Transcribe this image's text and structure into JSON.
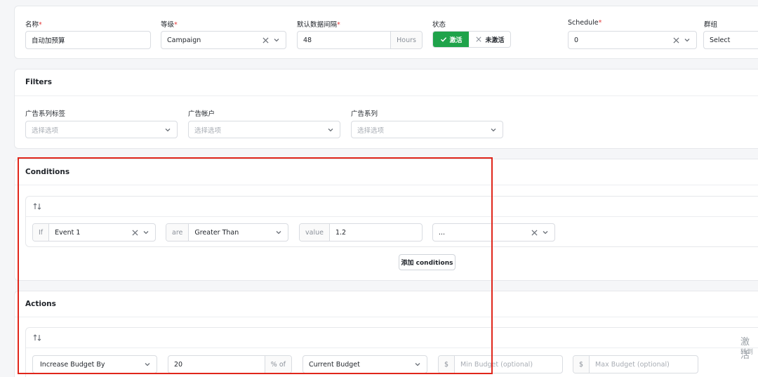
{
  "general": {
    "name_label": "名称",
    "name_value": "自动加预算",
    "level_label": "等级",
    "level_value": "Campaign",
    "interval_label": "默认数据间隔",
    "interval_value": "48",
    "interval_unit": "Hours",
    "status_label": "状态",
    "status_active": "激活",
    "status_inactive": "未激活",
    "schedule_label": "Schedule",
    "schedule_value": "0",
    "group_label": "群组",
    "group_value": "Select",
    "required_mark": "*"
  },
  "filters": {
    "title": "Filters",
    "items": [
      {
        "label": "广告系列标签",
        "placeholder": "选择选项"
      },
      {
        "label": "广告帐户",
        "placeholder": "选择选项"
      },
      {
        "label": "广告系列",
        "placeholder": "选择选项"
      }
    ]
  },
  "conditions": {
    "title": "Conditions",
    "if_label": "If",
    "event_value": "Event 1",
    "are_label": "are",
    "operator_value": "Greater Than",
    "value_label": "value",
    "value_value": "1.2",
    "extra_value": "...",
    "add_button": "添加 conditions"
  },
  "actions": {
    "title": "Actions",
    "action_value": "Increase Budget By",
    "amount_value": "20",
    "amount_unit": "% of",
    "base_value": "Current Budget",
    "currency1": "$",
    "min_placeholder": "Min Budget (optional)",
    "currency2": "$",
    "max_placeholder": "Max Budget (optional)"
  },
  "watermark": {
    "activate_text": "激活",
    "activate_sub": "转到"
  },
  "colors": {
    "accent_green": "#1fa34a",
    "highlight_red": "#e0261b"
  }
}
